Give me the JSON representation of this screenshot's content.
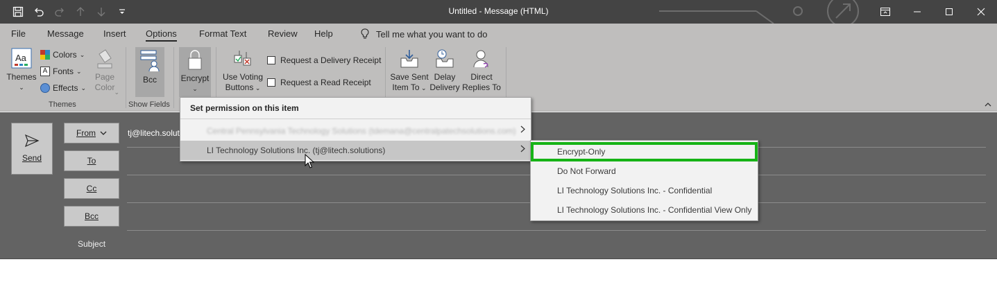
{
  "window": {
    "title": "Untitled  -  Message (HTML)"
  },
  "quick_access": {
    "icons": [
      "save-icon",
      "undo-icon",
      "redo-icon",
      "up-arrow-icon",
      "down-arrow-icon",
      "customize-icon"
    ]
  },
  "window_controls": {
    "icons": [
      "restore-ribbon-icon",
      "minimize-icon",
      "maximize-icon",
      "close-icon"
    ]
  },
  "menu_tabs": [
    {
      "label": "File"
    },
    {
      "label": "Message"
    },
    {
      "label": "Insert"
    },
    {
      "label": "Options",
      "active": true
    },
    {
      "label": "Format Text"
    },
    {
      "label": "Review"
    },
    {
      "label": "Help"
    }
  ],
  "tell_me": {
    "label": "Tell me what you want to do",
    "icon": "lightbulb-icon"
  },
  "ribbon": {
    "themes_group": {
      "label": "Themes",
      "themes_label": "Themes",
      "colors_label": "Colors",
      "fonts_label": "Fonts",
      "effects_label": "Effects",
      "page_color_label": "Page Color"
    },
    "show_fields_group": {
      "label": "Show Fields",
      "bcc_label": "Bcc"
    },
    "encrypt_label": "Encrypt",
    "voting_label_1": "Use Voting",
    "voting_label_2": "Buttons",
    "delivery_receipt_label": "Request a Delivery Receipt",
    "read_receipt_label": "Request a Read Receipt",
    "save_sent_1": "Save Sent",
    "save_sent_2": "Item To",
    "delay_1": "Delay",
    "delay_2": "Delivery",
    "direct_1": "Direct",
    "direct_2": "Replies To"
  },
  "compose": {
    "send_label": "Send",
    "from_label": "From",
    "from_value": "tj@litech.solut",
    "to_label": "To",
    "cc_label": "Cc",
    "bcc_label": "Bcc",
    "subject_label": "Subject"
  },
  "permission_menu": {
    "header": "Set permission on this item",
    "items": [
      {
        "label": "Central Pennsylvania Technology Solutions (tdemana@centralpatechsolutions.com)",
        "blurred": true
      },
      {
        "label": "LI Technology Solutions Inc. (tj@litech.solutions)",
        "hover": true
      }
    ]
  },
  "submenu": {
    "items": [
      {
        "label": "Encrypt-Only",
        "highlighted": true
      },
      {
        "label": "Do Not Forward"
      },
      {
        "label": "LI Technology Solutions Inc. - Confidential"
      },
      {
        "label": "LI Technology Solutions Inc. - Confidential View Only"
      }
    ]
  },
  "colors": {
    "titlebar": "#444444",
    "ribbon": "#bfbebd",
    "compose": "#636363",
    "highlight": "#16b316"
  }
}
